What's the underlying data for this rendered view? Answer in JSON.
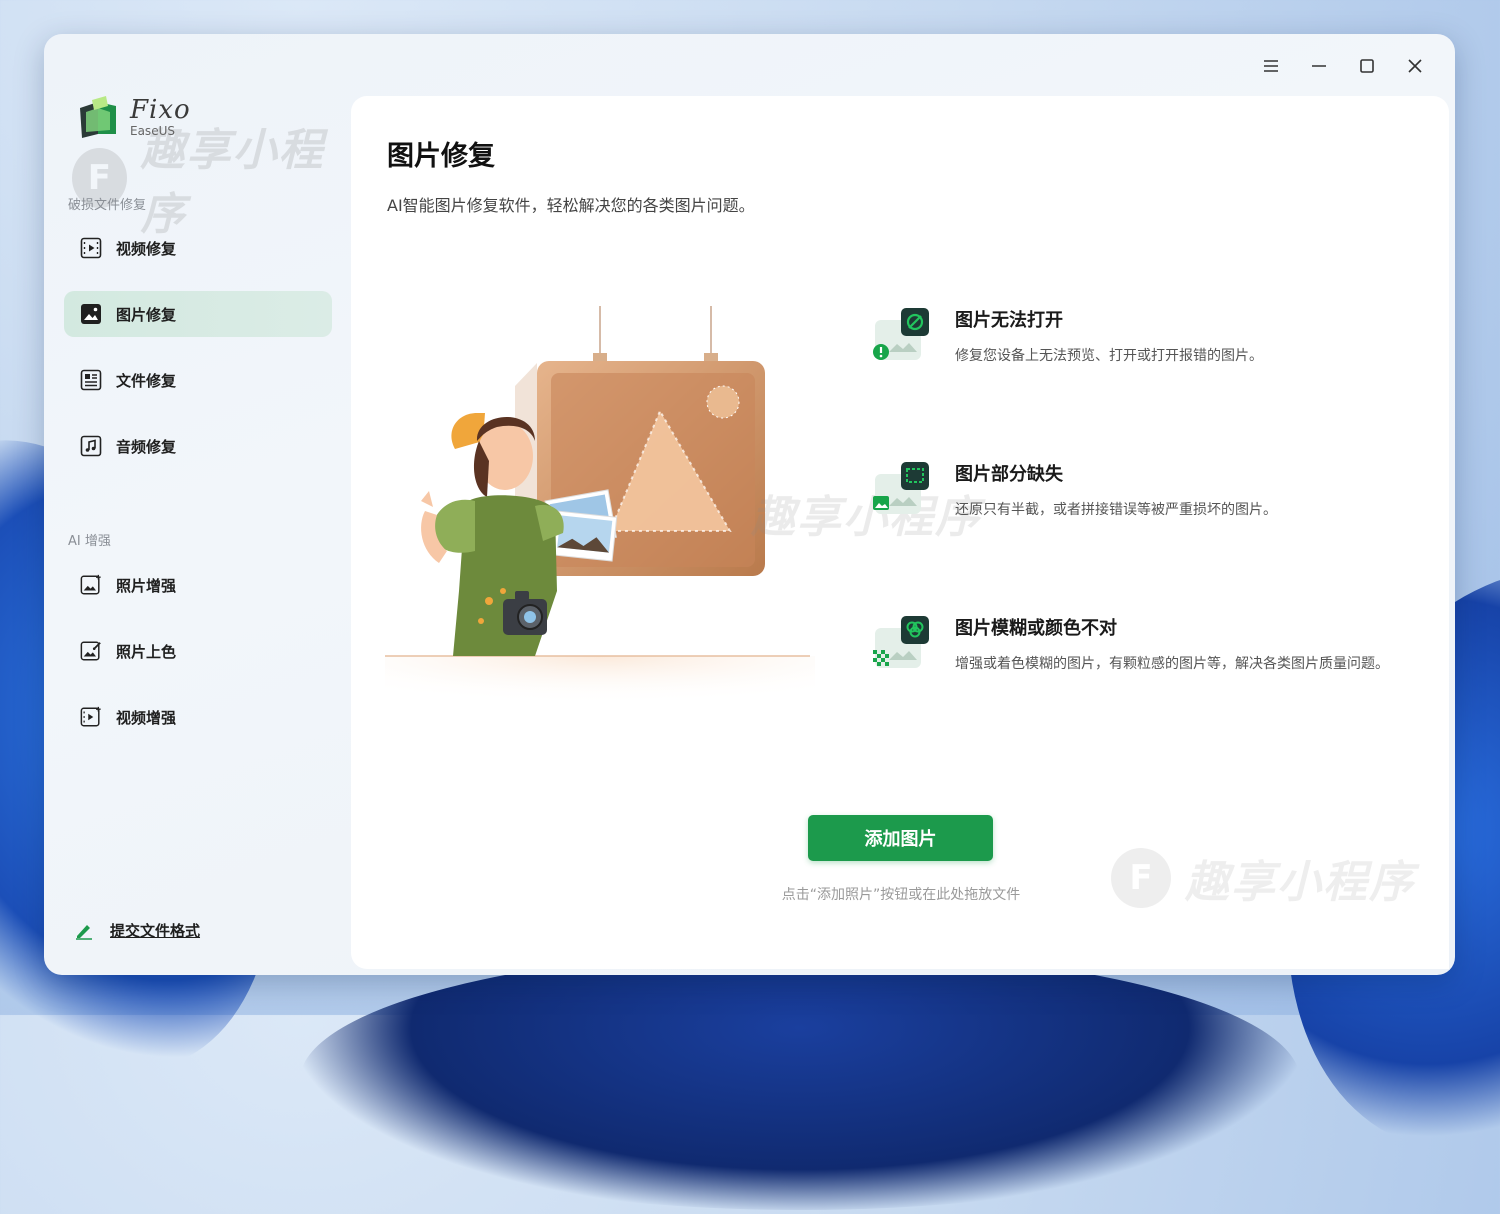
{
  "app": {
    "logo_title": "Fixo",
    "logo_subtitle": "EaseUS",
    "watermark_text": "趣享小程序",
    "watermark_letter": "F"
  },
  "titlebar": {
    "menu_icon": "hamburger-icon",
    "minimize_icon": "minimize-icon",
    "maximize_icon": "maximize-icon",
    "close_icon": "close-icon"
  },
  "sidebar": {
    "section_repair": "破损文件修复",
    "repair_items": [
      {
        "label": "视频修复",
        "icon": "video-file-icon",
        "active": false
      },
      {
        "label": "图片修复",
        "icon": "image-file-icon",
        "active": true
      },
      {
        "label": "文件修复",
        "icon": "document-file-icon",
        "active": false
      },
      {
        "label": "音频修复",
        "icon": "audio-file-icon",
        "active": false
      }
    ],
    "section_ai": "AI 增强",
    "ai_items": [
      {
        "label": "照片增强",
        "icon": "photo-enhance-icon"
      },
      {
        "label": "照片上色",
        "icon": "photo-colorize-icon"
      },
      {
        "label": "视频增强",
        "icon": "video-enhance-icon"
      }
    ],
    "submit_format": "提交文件格式"
  },
  "main": {
    "title": "图片修复",
    "subtitle": "AI智能图片修复软件，轻松解决您的各类图片问题。",
    "features": [
      {
        "title": "图片无法打开",
        "desc": "修复您设备上无法预览、打开或打开报错的图片。",
        "icon": "broken-image-icon"
      },
      {
        "title": "图片部分缺失",
        "desc": "还原只有半截，或者拼接错误等被严重损坏的图片。",
        "icon": "partial-image-icon"
      },
      {
        "title": "图片模糊或颜色不对",
        "desc": "增强或着色模糊的图片，有颗粒感的图片等，解决各类图片质量问题。",
        "icon": "blurry-image-icon"
      }
    ],
    "add_button": "添加图片",
    "hint": "点击“添加照片”按钮或在此处拖放文件"
  },
  "colors": {
    "accent": "#1c9a4c",
    "active_nav_bg": "#d3e9e0",
    "icon_dark": "#1d3a35",
    "icon_green": "#22c55e"
  }
}
